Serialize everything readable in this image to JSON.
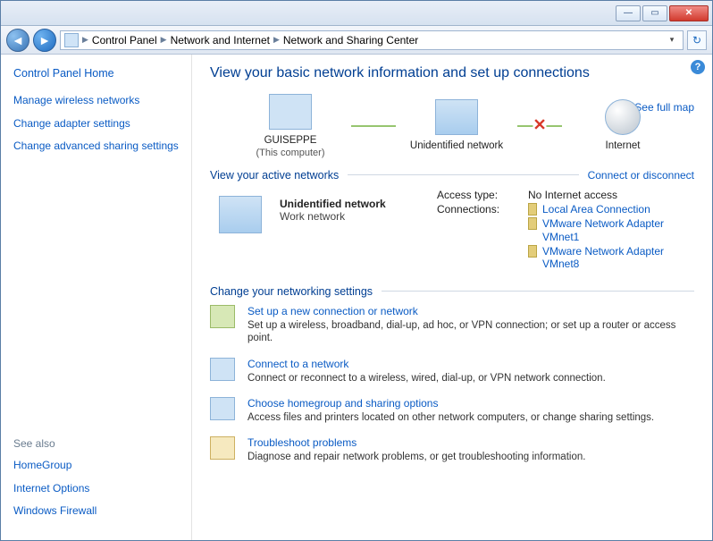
{
  "breadcrumb": {
    "items": [
      "Control Panel",
      "Network and Internet",
      "Network and Sharing Center"
    ]
  },
  "sidebar": {
    "home": "Control Panel Home",
    "links": [
      "Manage wireless networks",
      "Change adapter settings",
      "Change advanced sharing settings"
    ],
    "see_also_header": "See also",
    "see_also": [
      "HomeGroup",
      "Internet Options",
      "Windows Firewall"
    ]
  },
  "page": {
    "title": "View your basic network information and set up connections",
    "full_map": "See full map",
    "map": {
      "node1_label": "GUISEPPE",
      "node1_sub": "(This computer)",
      "node2_label": "Unidentified network",
      "node3_label": "Internet"
    },
    "active_header": "View your active networks",
    "active_link": "Connect or disconnect",
    "active": {
      "name": "Unidentified network",
      "type": "Work network",
      "access_key": "Access type:",
      "access_val": "No Internet access",
      "conn_key": "Connections:",
      "connections": [
        "Local Area Connection",
        "VMware Network Adapter VMnet1",
        "VMware Network Adapter VMnet8"
      ]
    },
    "change_header": "Change your networking settings",
    "tasks": [
      {
        "title": "Set up a new connection or network",
        "desc": "Set up a wireless, broadband, dial-up, ad hoc, or VPN connection; or set up a router or access point."
      },
      {
        "title": "Connect to a network",
        "desc": "Connect or reconnect to a wireless, wired, dial-up, or VPN network connection."
      },
      {
        "title": "Choose homegroup and sharing options",
        "desc": "Access files and printers located on other network computers, or change sharing settings."
      },
      {
        "title": "Troubleshoot problems",
        "desc": "Diagnose and repair network problems, or get troubleshooting information."
      }
    ]
  }
}
